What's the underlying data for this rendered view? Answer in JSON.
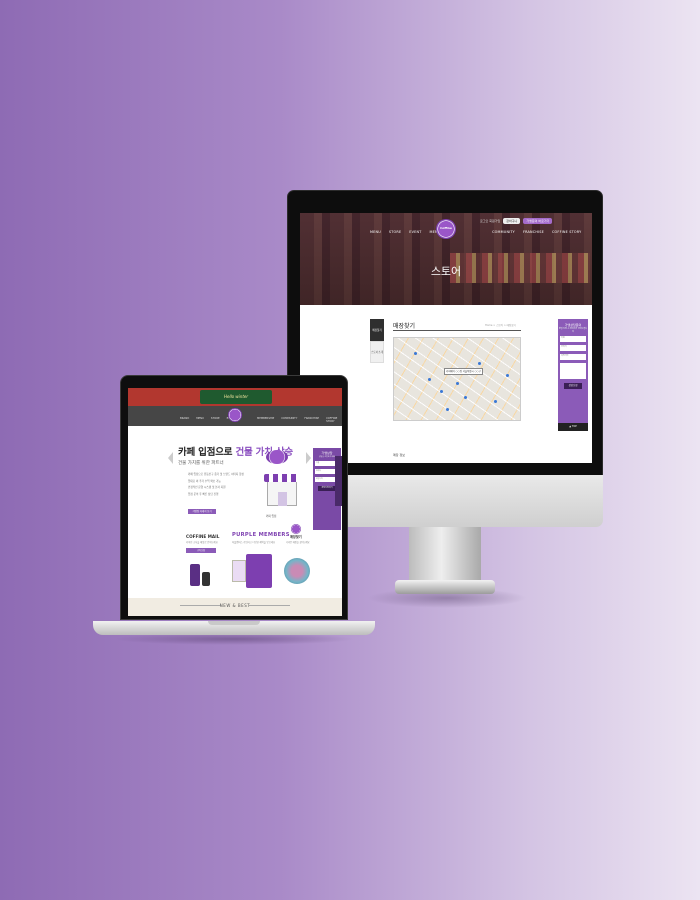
{
  "desktop": {
    "topbar": {
      "links": "로그인 회원가입",
      "pill_white": "장바구니",
      "pill_purple": "가맹문의 바로가기"
    },
    "nav": [
      "MENU",
      "STORE",
      "EVENT",
      "MEMBERSHIP",
      "COMMUNITY",
      "FRANCHISE",
      "COFFINE STORY"
    ],
    "logo": "Coffine",
    "hero_title": "스토어",
    "side_nav": {
      "active": "매장찾기",
      "inactive": "스토어소개"
    },
    "page_title": "매장찾기",
    "breadcrumb": "Home > 스토어 > 매장찾기",
    "map_label": "커피베이 ○○점\n서울특별시 ○○구",
    "form": {
      "title": "가맹상담문의",
      "subtitle": "창업 신청 시 담당자가 연락드립니다",
      "fields": [
        "이름",
        "연락처",
        "희망지역"
      ],
      "textarea_placeholder": "문의내용",
      "submit": "상담신청",
      "footer": "▲ TOP"
    },
    "bottom_text": "매장 정보"
  },
  "laptop": {
    "banner": "Hello winter",
    "nav": [
      "BRAND",
      "MENU",
      "STORE",
      "EVENT",
      "MEMBERSHIP",
      "COMMUNITY",
      "FRANCHISE",
      "COFFINE STORY"
    ],
    "headline_a": "카페 입점으로 ",
    "headline_b": "건물 가치 상승",
    "subheadline": "건물 가치를 위한 파트너",
    "list": [
      "카페 입점으로 유동인구 증가 및 브랜드 이미지 향상",
      "임대료 외 추가 수익 확보 가능",
      "안정적인 운영 시스템 및 본사 지원",
      "입점 문의 후 빠른 상담 진행"
    ],
    "cta": "가맹점 자세히 보기",
    "store_caption": "커피 입점",
    "form": {
      "title": "가맹상담",
      "subtitle": "상담을 신청해 주세요",
      "fields": [
        "이름",
        "연락처",
        "희망지역"
      ],
      "submit": "상담신청하기"
    },
    "cofme": {
      "title": "COFFINE MAIL",
      "sub": "커피인 소식을 메일로 받아보세요",
      "btn": "구독신청"
    },
    "purple": {
      "title": "PURPLE MEMBERS",
      "sub": "퍼플멤버스 가입하고 다양한 혜택을 받으세요"
    },
    "find": {
      "title": "매장찾기",
      "sub": "가까운 매장을 찾아보세요"
    },
    "new_best": "NEW & BEST"
  }
}
